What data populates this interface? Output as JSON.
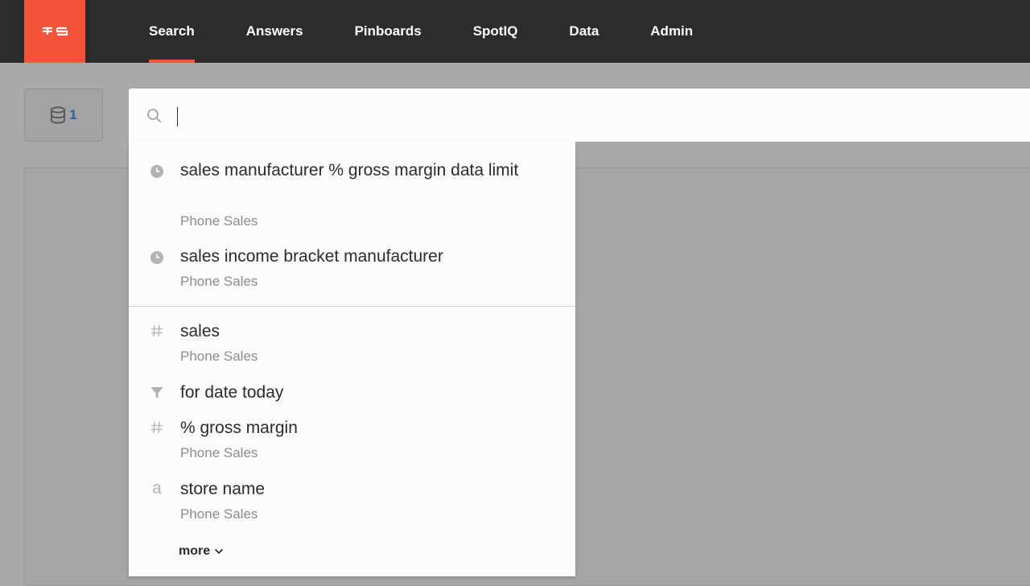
{
  "nav": {
    "items": [
      {
        "label": "Search",
        "active": true
      },
      {
        "label": "Answers",
        "active": false
      },
      {
        "label": "Pinboards",
        "active": false
      },
      {
        "label": "SpotIQ",
        "active": false
      },
      {
        "label": "Data",
        "active": false
      },
      {
        "label": "Admin",
        "active": false
      }
    ]
  },
  "source_button": {
    "count": "1",
    "icon": "database-icon"
  },
  "search": {
    "value": "",
    "icon": "search-icon"
  },
  "suggestions": {
    "recent": [
      {
        "icon": "clock-icon",
        "text": "sales manufacturer % gross margin data limit",
        "source": "Phone Sales"
      },
      {
        "icon": "clock-icon",
        "text": "sales income bracket manufacturer",
        "source": "Phone Sales"
      }
    ],
    "columns": [
      {
        "icon": "hash-icon",
        "text": "sales",
        "source": "Phone Sales"
      },
      {
        "icon": "filter-icon",
        "text": "for date today",
        "source": ""
      },
      {
        "icon": "hash-icon",
        "text": "% gross margin",
        "source": "Phone Sales"
      },
      {
        "icon": "attribute-icon",
        "text": "store name",
        "source": "Phone Sales"
      }
    ],
    "more_label": "more"
  },
  "colors": {
    "accent": "#f4553a",
    "topbar": "#2c2c2c",
    "overlay": "#a9a9a9",
    "link_blue": "#2f5fa8"
  }
}
